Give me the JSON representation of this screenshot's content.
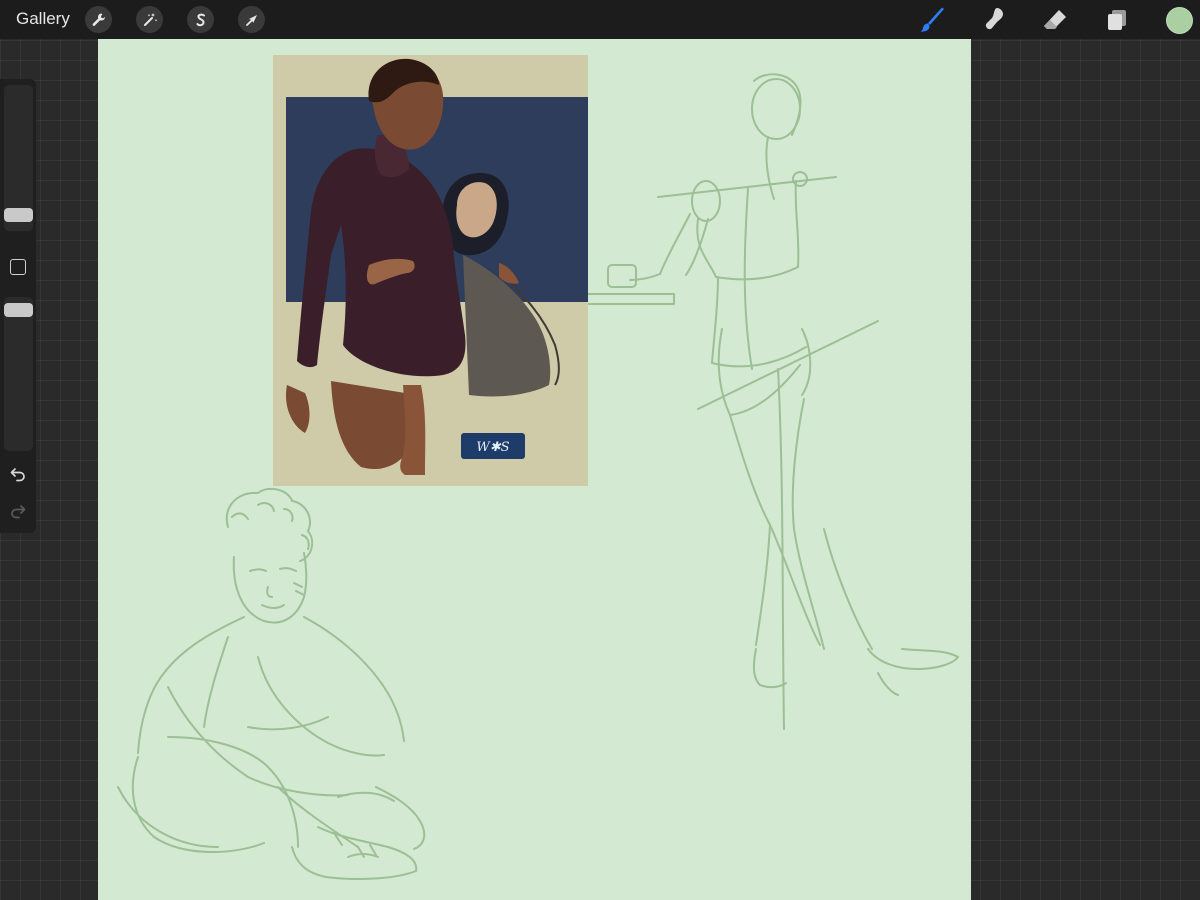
{
  "toolbar": {
    "gallery_label": "Gallery",
    "left_tools": [
      "wrench-icon",
      "magic-wand-icon",
      "selection-s-icon",
      "transform-arrow-icon"
    ],
    "right_tools": [
      "brush-icon",
      "smudge-icon",
      "eraser-icon",
      "layers-icon"
    ],
    "active_tool": "brush-icon",
    "active_tool_color": "#2f7cf6",
    "current_color": "#a9cfa3"
  },
  "sidebar": {
    "brush_size_level": 0.45,
    "opacity_level": 0.7
  },
  "canvas": {
    "background_color": "#d4e9d2",
    "sketch_color": "#9cbf95"
  },
  "artwork": {
    "signature": "W✱S"
  }
}
